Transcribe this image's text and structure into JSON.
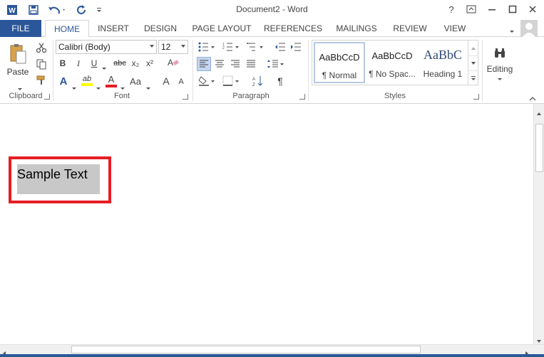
{
  "window": {
    "title": "Document2 - Word",
    "help_label": "?"
  },
  "tabs": {
    "file": "FILE",
    "items": [
      "HOME",
      "INSERT",
      "DESIGN",
      "PAGE LAYOUT",
      "REFERENCES",
      "MAILINGS",
      "REVIEW",
      "VIEW"
    ],
    "active": "HOME"
  },
  "clipboard": {
    "paste_label": "Paste",
    "group_label": "Clipboard"
  },
  "font": {
    "family": "Calibri (Body)",
    "size": "12",
    "bold": "B",
    "italic": "I",
    "underline": "U",
    "strike": "abc",
    "subscript": "x₂",
    "superscript": "x²",
    "text_effects": "A",
    "highlight": "ab",
    "font_color": "A",
    "change_case": "Aa",
    "grow": "A",
    "shrink": "A",
    "group_label": "Font"
  },
  "paragraph": {
    "group_label": "Paragraph",
    "pilcrow": "¶"
  },
  "styles": {
    "group_label": "Styles",
    "items": [
      {
        "preview": "AaBbCcD",
        "name": "¶ Normal"
      },
      {
        "preview": "AaBbCcD",
        "name": "¶ No Spac..."
      },
      {
        "preview": "AaBbC",
        "name": "Heading 1"
      }
    ]
  },
  "editing": {
    "label": "Editing"
  },
  "document": {
    "sample_text": "Sample Text"
  },
  "colors": {
    "accent": "#2b579a",
    "highlight_box": "#e51d24",
    "text_shading": "#c8c8c8",
    "highlighter": "#ffff00",
    "font_color_bar": "#e51d24"
  }
}
